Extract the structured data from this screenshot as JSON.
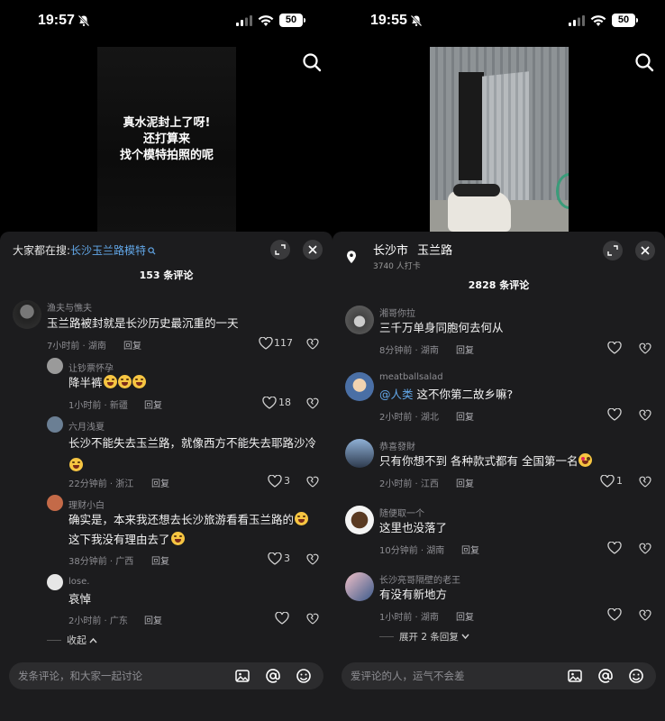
{
  "left": {
    "status": {
      "time": "19:57",
      "battery": "50"
    },
    "video_caption": [
      "真水泥封上了呀!",
      "还打算来",
      "找个模特拍照的呢"
    ],
    "hot_search": {
      "prefix": "大家都在搜:",
      "keyword": "长沙玉兰路模特"
    },
    "comment_count": "153 条评论",
    "comments": [
      {
        "user": "渔夫与憔夫",
        "text": "玉兰路被封就是长沙历史最沉重的一天",
        "meta": "7小时前 · 湖南",
        "reply": "回复",
        "likes": "117"
      },
      {
        "user": "让钞票怀孕",
        "text": "降半裤",
        "meta": "1小时前 · 新疆",
        "reply": "回复",
        "likes": "18"
      },
      {
        "user": "六月浅夏",
        "text": "长沙不能失去玉兰路，就像西方不能失去耶路沙冷",
        "meta": "22分钟前 · 浙江",
        "reply": "回复",
        "likes": "3"
      },
      {
        "user": "理财小白",
        "text": "确实是，本来我还想去长沙旅游看看玉兰路的",
        "text2": "这下我没有理由去了",
        "meta": "38分钟前 · 广西",
        "reply": "回复",
        "likes": "3"
      },
      {
        "user": "lose.",
        "text": "哀悼",
        "meta": "2小时前 · 广东",
        "reply": "回复",
        "likes": ""
      }
    ],
    "collapse": "收起",
    "input_placeholder": "发条评论，和大家一起讨论"
  },
  "right": {
    "status": {
      "time": "19:55",
      "battery": "50"
    },
    "location": {
      "city": "长沙市",
      "place": "玉兰路",
      "checkins": "3740 人打卡"
    },
    "comment_count": "2828 条评论",
    "comments": [
      {
        "user": "湘哥你拉",
        "text": "三千万单身同胞何去何从",
        "meta": "8分钟前 · 湖南",
        "reply": "回复",
        "likes": ""
      },
      {
        "user": "meatballsalad",
        "mention": "@人类",
        "text": " 这不你第二故乡嘛?",
        "meta": "2小时前 · 湖北",
        "reply": "回复",
        "likes": ""
      },
      {
        "user": "恭喜發財",
        "text": "只有你想不到 各种款式都有 全国第一名",
        "meta": "2小时前 · 江西",
        "reply": "回复",
        "likes": "1"
      },
      {
        "user": "随便取一个",
        "text": "这里也没落了",
        "meta": "10分钟前 · 湖南",
        "reply": "回复",
        "likes": ""
      },
      {
        "user": "长沙亮哥隔壁的老王",
        "text": "有没有新地方",
        "meta": "1小时前 · 湖南",
        "reply": "回复",
        "likes": ""
      }
    ],
    "expand": "展开 2 条回复",
    "input_placeholder": "爱评论的人，运气不会差"
  },
  "colors": {
    "sheet": "#1c1c1e",
    "link": "#62a7e8",
    "muted": "#8e8e93"
  }
}
